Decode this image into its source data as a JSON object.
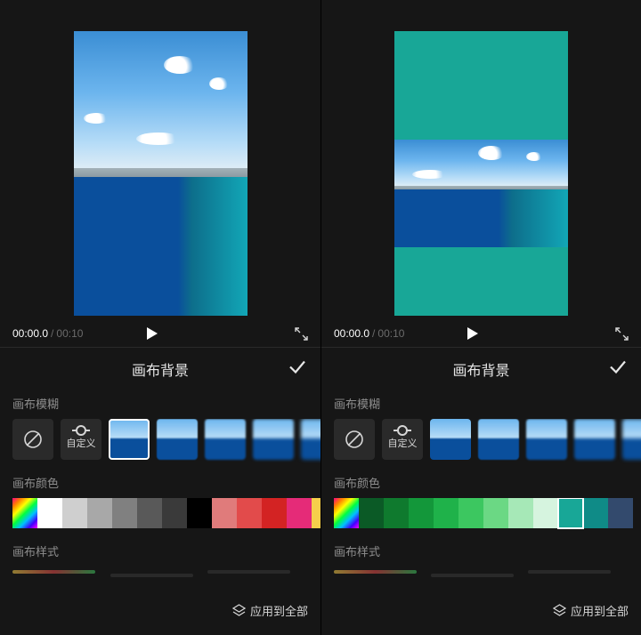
{
  "left": {
    "transport": {
      "current": "00:00.0",
      "duration": "00:10"
    },
    "header": {
      "title": "画布背景"
    },
    "sections": {
      "blur_label": "画布模糊",
      "custom_label": "自定义",
      "color_label": "画布颜色",
      "style_label": "画布样式",
      "apply_all": "应用到全部"
    },
    "colors": [
      "rainbow",
      "#ffffff",
      "#cfcfcf",
      "#a8a8a8",
      "#808080",
      "#595959",
      "#3a3a3a",
      "#000000",
      "#e07b7b",
      "#e24b4b",
      "#d32323",
      "#e52b78",
      "#f6cf4b",
      "#f2e24a"
    ],
    "selected_color_index": -1,
    "blur_selected_index": 2
  },
  "right": {
    "transport": {
      "current": "00:00.0",
      "duration": "00:10"
    },
    "header": {
      "title": "画布背景"
    },
    "sections": {
      "blur_label": "画布模糊",
      "custom_label": "自定义",
      "color_label": "画布颜色",
      "style_label": "画布样式",
      "apply_all": "应用到全部"
    },
    "colors": [
      "rainbow",
      "#0b5a26",
      "#0f7a2e",
      "#13973a",
      "#1fb24a",
      "#3cc760",
      "#6bd884",
      "#a6e8b7",
      "#d6f4df",
      "#18a797",
      "#0f8b87",
      "#334a6d"
    ],
    "selected_color_index": 9,
    "blur_selected_index": -1
  }
}
